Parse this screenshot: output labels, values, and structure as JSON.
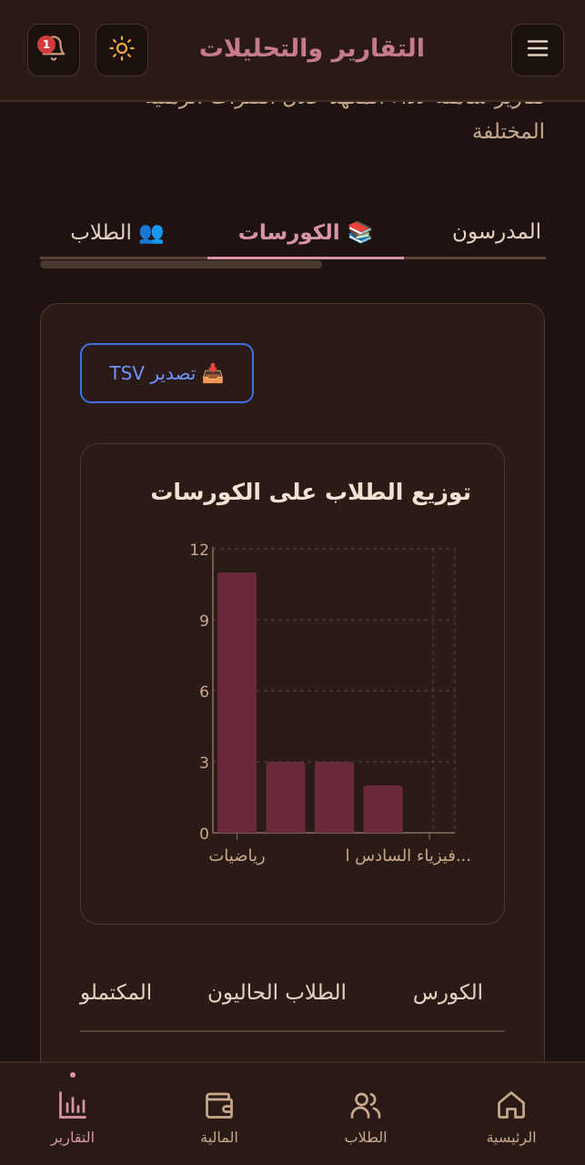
{
  "header": {
    "title": "التقارير والتحليلات",
    "notification_count": "1"
  },
  "description": {
    "line1": "تقارير شاملة لأداء المعهد خلال الفترات الزمنية",
    "line2": "المختلفة"
  },
  "tabs": [
    {
      "label": "المدرسون"
    },
    {
      "label": "📚 الكورسات",
      "active": true
    },
    {
      "label": "👥 الطلاب"
    }
  ],
  "export": {
    "label": "📥 تصدير TSV"
  },
  "chart_data": {
    "type": "bar",
    "title": "توزيع الطلاب على الكورسات",
    "categories": [
      "رياضيات",
      "",
      "",
      "فيزياء السادس ا..."
    ],
    "values": [
      11,
      3,
      3,
      2
    ],
    "ylim": [
      0,
      12
    ],
    "yticks": [
      "0",
      "3",
      "6",
      "9",
      "12"
    ],
    "grid": true,
    "bar_color": "#6b2a3c"
  },
  "table": {
    "headers": [
      "الكورس",
      "الطلاب الحاليون",
      "المكتملو"
    ]
  },
  "bottom_nav": [
    {
      "label": "الرئيسية",
      "icon": "home-icon"
    },
    {
      "label": "الطلاب",
      "icon": "users-icon"
    },
    {
      "label": "المالية",
      "icon": "wallet-icon"
    },
    {
      "label": "التقارير",
      "icon": "bar-chart-icon",
      "active": true
    }
  ],
  "colors": {
    "accent": "#d994a5",
    "title": "#c77a8e",
    "export_blue": "#3f6fe0"
  }
}
